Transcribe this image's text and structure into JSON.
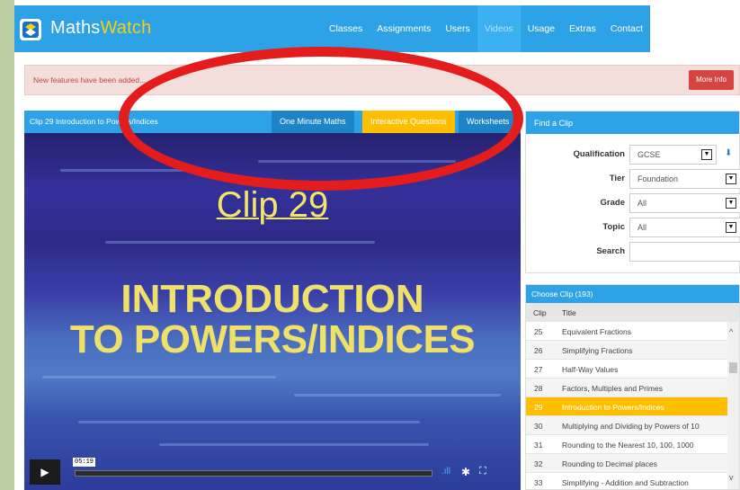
{
  "nav": {
    "brand_part1": "Maths",
    "brand_part2": "Watch",
    "links": [
      "Classes",
      "Assignments",
      "Users",
      "Videos",
      "Usage",
      "Extras",
      "Contact"
    ],
    "active": "Videos"
  },
  "alert": {
    "text": "New features have been added...",
    "button": "More Info"
  },
  "video": {
    "title": "Clip 29 Introduction to Powers/Indices",
    "tabs": [
      "One Minute Maths",
      "Interactive Questions",
      "Worksheets"
    ],
    "slide_clip": "Clip 29",
    "slide_title_line1": "INTRODUCTION",
    "slide_title_line2": "TO POWERS/INDICES",
    "time": "05:19"
  },
  "find": {
    "header": "Find a Clip",
    "fields": [
      {
        "label": "Qualification",
        "value": "GCSE"
      },
      {
        "label": "Tier",
        "value": "Foundation"
      },
      {
        "label": "Grade",
        "value": "All"
      },
      {
        "label": "Topic",
        "value": "All"
      },
      {
        "label": "Search",
        "value": ""
      }
    ]
  },
  "choose": {
    "header": "Choose Clip (193)",
    "col_clip": "Clip",
    "col_title": "Title",
    "selected": "29",
    "rows": [
      {
        "clip": "25",
        "title": "Equivalent Fractions"
      },
      {
        "clip": "26",
        "title": "Simplifying Fractions"
      },
      {
        "clip": "27",
        "title": "Half-Way Values"
      },
      {
        "clip": "28",
        "title": "Factors, Multiples and Primes"
      },
      {
        "clip": "29",
        "title": "Introduction to Powers/Indices"
      },
      {
        "clip": "30",
        "title": "Multiplying and Dividing by Powers of 10"
      },
      {
        "clip": "31",
        "title": "Rounding to the Nearest 10, 100, 1000"
      },
      {
        "clip": "32",
        "title": "Rounding to Decimal places"
      },
      {
        "clip": "33",
        "title": "Simplifying - Addition and Subtraction"
      }
    ]
  },
  "colors": {
    "primary": "#2ea2e6",
    "accent": "#ffbf00",
    "alert_button": "#d64541",
    "annotation": "#e41c1c"
  }
}
